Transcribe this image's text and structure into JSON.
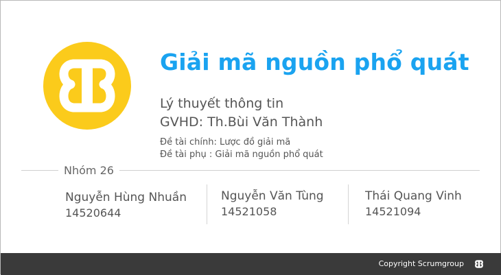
{
  "header": {
    "title": "Giải mã nguồn phổ quát"
  },
  "info": {
    "subject": "Lý thuyết thông tin",
    "advisor": "GVHD: Th.Bùi Văn Thành",
    "topic_main": "Đề tài chính: Lược đồ giải mã",
    "topic_sub": "Đề tài phụ   : Giải mã nguồn phổ quát"
  },
  "group": {
    "label": "Nhóm 26",
    "members": [
      {
        "name": "Nguyễn Hùng Nhuần",
        "id": "14520644"
      },
      {
        "name": "Nguyễn Văn Tùng",
        "id": "14521058"
      },
      {
        "name": "Thái Quang Vinh",
        "id": "14521094"
      }
    ]
  },
  "footer": {
    "copyright": "Copyright Scrumgroup"
  },
  "colors": {
    "accent": "#1aa3f0",
    "logo": "#fbcb1b",
    "footer_bg": "#3a3a3a",
    "text": "#555555"
  },
  "icons": {
    "main_logo": "scrumgroup-logo-icon",
    "footer_logo": "scrumgroup-logo-icon"
  }
}
